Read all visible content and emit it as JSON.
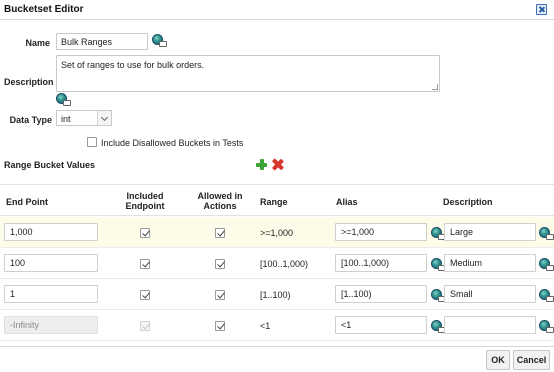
{
  "window": {
    "title": "Bucketset Editor"
  },
  "form": {
    "name_label": "Name",
    "name_value": "Bulk Ranges",
    "description_label": "Description",
    "description_value": "Set of ranges to use for bulk orders.",
    "datatype_label": "Data Type",
    "datatype_value": "int",
    "include_disallowed_label": "Include Disallowed Buckets in Tests",
    "include_disallowed_checked": false
  },
  "section": {
    "title": "Range Bucket Values"
  },
  "table": {
    "headers": {
      "end_point": "End Point",
      "included_endpoint": "Included Endpoint",
      "allowed_in_actions": "Allowed in Actions",
      "range": "Range",
      "alias": "Alias",
      "description": "Description"
    },
    "rows": [
      {
        "end_point": "1,000",
        "included": true,
        "allowed": true,
        "range": ">=1,000",
        "alias": ">=1,000",
        "description": "Large"
      },
      {
        "end_point": "100",
        "included": true,
        "allowed": true,
        "range": "[100..1,000)",
        "alias": "[100..1,000)",
        "description": "Medium"
      },
      {
        "end_point": "1",
        "included": true,
        "allowed": true,
        "range": "[1..100)",
        "alias": "[1..100)",
        "description": "Small"
      },
      {
        "end_point": "-Infinity",
        "included": true,
        "allowed": true,
        "range": "<1",
        "alias": "<1",
        "description": ""
      }
    ]
  },
  "buttons": {
    "ok": "OK",
    "cancel": "Cancel"
  }
}
